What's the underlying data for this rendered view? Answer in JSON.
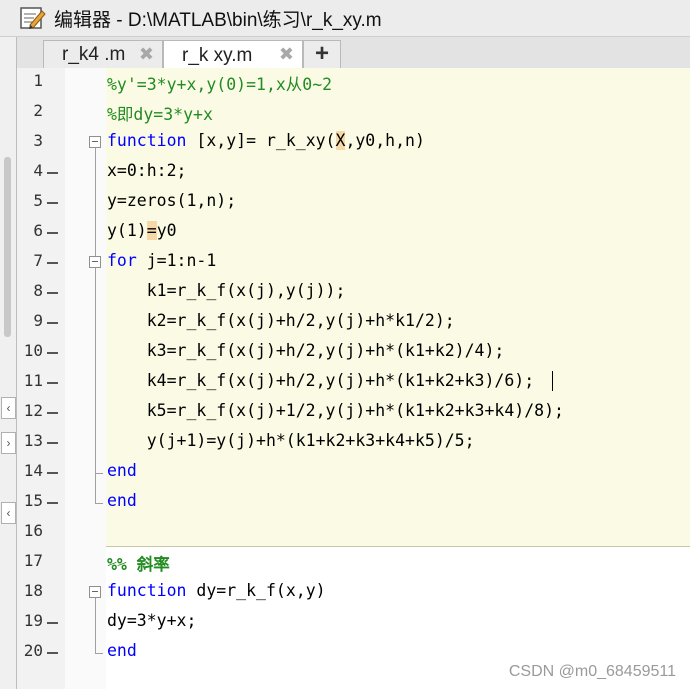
{
  "window": {
    "title": "编辑器 - D:\\MATLAB\\bin\\练习\\r_k_xy.m"
  },
  "tabs": [
    {
      "label": "r_k4 .m",
      "close": "✖"
    },
    {
      "label": "r_k xy.m",
      "close": "✖"
    }
  ],
  "add_tab_label": "+",
  "lines": [
    {
      "n": "1",
      "bp": false,
      "html": "<span class=\"cm\">%y'=3*y+x,y(0)=1,x从0~2</span>"
    },
    {
      "n": "2",
      "bp": false,
      "html": "<span class=\"cm\">%即dy=3*y+x</span>"
    },
    {
      "n": "3",
      "bp": false,
      "html": "<span class=\"kw\">function</span> [x,y]= r_k_xy(<span class=\"hl\">X</span>,y0,h,n)"
    },
    {
      "n": "4",
      "bp": true,
      "html": "x=0:h:2;"
    },
    {
      "n": "5",
      "bp": true,
      "html": "y=zeros(1,n);"
    },
    {
      "n": "6",
      "bp": true,
      "html": "y(1)<span class=\"hl\">=</span>y0"
    },
    {
      "n": "7",
      "bp": true,
      "html": "<span class=\"kw\">for</span> j=1:n-1"
    },
    {
      "n": "8",
      "bp": true,
      "html": "    k1=r_k_f(x(j),y(j));"
    },
    {
      "n": "9",
      "bp": true,
      "html": "    k2=r_k_f(x(j)+h/2,y(j)+h*k1/2);"
    },
    {
      "n": "10",
      "bp": true,
      "html": "    k3=r_k_f(x(j)+h/2,y(j)+h*(k1+k2)/4);"
    },
    {
      "n": "11",
      "bp": true,
      "html": "    k4=r_k_f(x(j)+h/2,y(j)+h*(k1+k2+k3)/6);"
    },
    {
      "n": "12",
      "bp": true,
      "html": "    k5=r_k_f(x(j)+1/2,y(j)+h*(k1+k2+k3+k4)/8);"
    },
    {
      "n": "13",
      "bp": true,
      "html": "    y(j+1)=y(j)+h*(k1+k2+k3+k4+k5)/5;"
    },
    {
      "n": "14",
      "bp": true,
      "html": "<span class=\"kw\">end</span>"
    },
    {
      "n": "15",
      "bp": true,
      "html": "<span class=\"kw\">end</span>"
    },
    {
      "n": "16",
      "bp": false,
      "html": ""
    },
    {
      "n": "17",
      "bp": false,
      "html": "<span class=\"cb\">%% 斜率</span>"
    },
    {
      "n": "18",
      "bp": false,
      "html": "<span class=\"kw\">function</span> dy=r_k_f(x,y)"
    },
    {
      "n": "19",
      "bp": true,
      "html": "dy=3*y+x;"
    },
    {
      "n": "20",
      "bp": true,
      "html": "<span class=\"kw\">end</span>"
    }
  ],
  "watermark": "CSDN @m0_68459511",
  "colors": {
    "keyword": "#0000ff",
    "comment": "#228b22",
    "cell_bg": "#fbfbe5",
    "highlight": "#f5d9a8"
  }
}
